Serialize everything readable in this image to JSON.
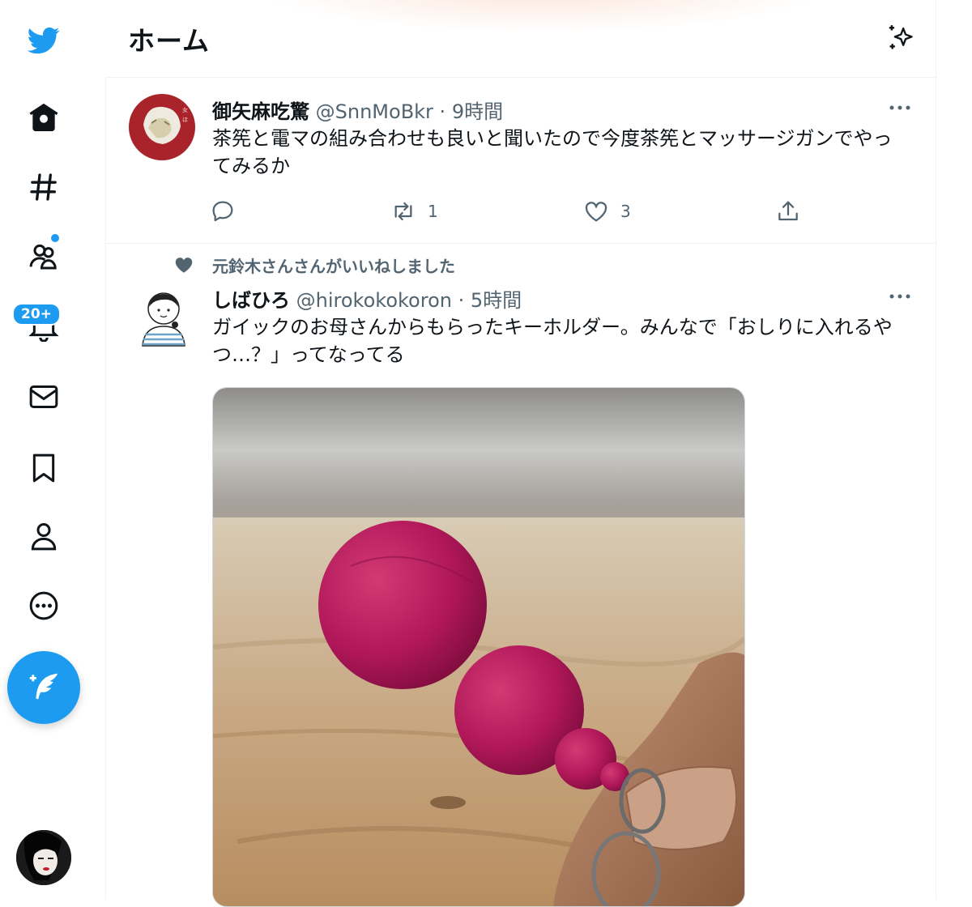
{
  "colors": {
    "accent": "#1d9bf0",
    "text": "#0f1419",
    "muted": "#536471",
    "divider": "#eff3f4"
  },
  "nav": {
    "items": [
      {
        "name": "home",
        "icon": "home-icon"
      },
      {
        "name": "explore",
        "icon": "hashtag-icon"
      },
      {
        "name": "communities",
        "icon": "people-icon"
      },
      {
        "name": "notifications",
        "icon": "bell-icon"
      },
      {
        "name": "messages",
        "icon": "envelope-icon"
      },
      {
        "name": "bookmarks",
        "icon": "bookmark-icon"
      },
      {
        "name": "profile",
        "icon": "person-icon"
      },
      {
        "name": "more",
        "icon": "more-circle-icon"
      }
    ],
    "notification_badge": "20+",
    "compose_icon": "compose-feather-icon"
  },
  "header": {
    "title": "ホーム",
    "icon": "sparkle-icon"
  },
  "tweets": [
    {
      "name": "御矢麻吃驚",
      "handle": "@SnnMoBkr",
      "sep": " · ",
      "time": "9時間",
      "text": "茶筅と電マの組み合わせも良いと聞いたので今度茶筅とマッサージガンでやってみるか",
      "actions": {
        "reply": "",
        "retweet": "1",
        "like": "3",
        "share": ""
      }
    },
    {
      "social_context": "元鈴木さんさんがいいねしました",
      "name": "しばひろ",
      "handle": "@hirokokokoron",
      "sep": " · ",
      "time": "5時間",
      "text": "ガイックのお母さんからもらったキーホルダー。みんなで「おしりに入れるやつ…？」ってなってる"
    }
  ]
}
